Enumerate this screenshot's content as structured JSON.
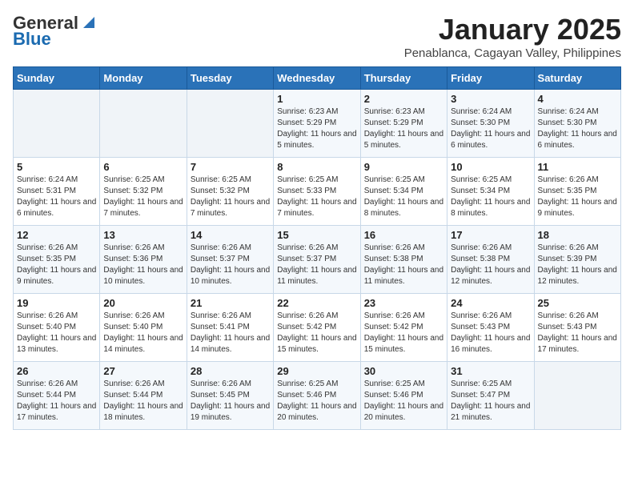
{
  "logo": {
    "general": "General",
    "blue": "Blue"
  },
  "title": "January 2025",
  "location": "Penablanca, Cagayan Valley, Philippines",
  "days_of_week": [
    "Sunday",
    "Monday",
    "Tuesday",
    "Wednesday",
    "Thursday",
    "Friday",
    "Saturday"
  ],
  "weeks": [
    [
      {
        "day": "",
        "sunrise": "",
        "sunset": "",
        "daylight": ""
      },
      {
        "day": "",
        "sunrise": "",
        "sunset": "",
        "daylight": ""
      },
      {
        "day": "",
        "sunrise": "",
        "sunset": "",
        "daylight": ""
      },
      {
        "day": "1",
        "sunrise": "Sunrise: 6:23 AM",
        "sunset": "Sunset: 5:29 PM",
        "daylight": "Daylight: 11 hours and 5 minutes."
      },
      {
        "day": "2",
        "sunrise": "Sunrise: 6:23 AM",
        "sunset": "Sunset: 5:29 PM",
        "daylight": "Daylight: 11 hours and 5 minutes."
      },
      {
        "day": "3",
        "sunrise": "Sunrise: 6:24 AM",
        "sunset": "Sunset: 5:30 PM",
        "daylight": "Daylight: 11 hours and 6 minutes."
      },
      {
        "day": "4",
        "sunrise": "Sunrise: 6:24 AM",
        "sunset": "Sunset: 5:30 PM",
        "daylight": "Daylight: 11 hours and 6 minutes."
      }
    ],
    [
      {
        "day": "5",
        "sunrise": "Sunrise: 6:24 AM",
        "sunset": "Sunset: 5:31 PM",
        "daylight": "Daylight: 11 hours and 6 minutes."
      },
      {
        "day": "6",
        "sunrise": "Sunrise: 6:25 AM",
        "sunset": "Sunset: 5:32 PM",
        "daylight": "Daylight: 11 hours and 7 minutes."
      },
      {
        "day": "7",
        "sunrise": "Sunrise: 6:25 AM",
        "sunset": "Sunset: 5:32 PM",
        "daylight": "Daylight: 11 hours and 7 minutes."
      },
      {
        "day": "8",
        "sunrise": "Sunrise: 6:25 AM",
        "sunset": "Sunset: 5:33 PM",
        "daylight": "Daylight: 11 hours and 7 minutes."
      },
      {
        "day": "9",
        "sunrise": "Sunrise: 6:25 AM",
        "sunset": "Sunset: 5:34 PM",
        "daylight": "Daylight: 11 hours and 8 minutes."
      },
      {
        "day": "10",
        "sunrise": "Sunrise: 6:25 AM",
        "sunset": "Sunset: 5:34 PM",
        "daylight": "Daylight: 11 hours and 8 minutes."
      },
      {
        "day": "11",
        "sunrise": "Sunrise: 6:26 AM",
        "sunset": "Sunset: 5:35 PM",
        "daylight": "Daylight: 11 hours and 9 minutes."
      }
    ],
    [
      {
        "day": "12",
        "sunrise": "Sunrise: 6:26 AM",
        "sunset": "Sunset: 5:35 PM",
        "daylight": "Daylight: 11 hours and 9 minutes."
      },
      {
        "day": "13",
        "sunrise": "Sunrise: 6:26 AM",
        "sunset": "Sunset: 5:36 PM",
        "daylight": "Daylight: 11 hours and 10 minutes."
      },
      {
        "day": "14",
        "sunrise": "Sunrise: 6:26 AM",
        "sunset": "Sunset: 5:37 PM",
        "daylight": "Daylight: 11 hours and 10 minutes."
      },
      {
        "day": "15",
        "sunrise": "Sunrise: 6:26 AM",
        "sunset": "Sunset: 5:37 PM",
        "daylight": "Daylight: 11 hours and 11 minutes."
      },
      {
        "day": "16",
        "sunrise": "Sunrise: 6:26 AM",
        "sunset": "Sunset: 5:38 PM",
        "daylight": "Daylight: 11 hours and 11 minutes."
      },
      {
        "day": "17",
        "sunrise": "Sunrise: 6:26 AM",
        "sunset": "Sunset: 5:38 PM",
        "daylight": "Daylight: 11 hours and 12 minutes."
      },
      {
        "day": "18",
        "sunrise": "Sunrise: 6:26 AM",
        "sunset": "Sunset: 5:39 PM",
        "daylight": "Daylight: 11 hours and 12 minutes."
      }
    ],
    [
      {
        "day": "19",
        "sunrise": "Sunrise: 6:26 AM",
        "sunset": "Sunset: 5:40 PM",
        "daylight": "Daylight: 11 hours and 13 minutes."
      },
      {
        "day": "20",
        "sunrise": "Sunrise: 6:26 AM",
        "sunset": "Sunset: 5:40 PM",
        "daylight": "Daylight: 11 hours and 14 minutes."
      },
      {
        "day": "21",
        "sunrise": "Sunrise: 6:26 AM",
        "sunset": "Sunset: 5:41 PM",
        "daylight": "Daylight: 11 hours and 14 minutes."
      },
      {
        "day": "22",
        "sunrise": "Sunrise: 6:26 AM",
        "sunset": "Sunset: 5:42 PM",
        "daylight": "Daylight: 11 hours and 15 minutes."
      },
      {
        "day": "23",
        "sunrise": "Sunrise: 6:26 AM",
        "sunset": "Sunset: 5:42 PM",
        "daylight": "Daylight: 11 hours and 15 minutes."
      },
      {
        "day": "24",
        "sunrise": "Sunrise: 6:26 AM",
        "sunset": "Sunset: 5:43 PM",
        "daylight": "Daylight: 11 hours and 16 minutes."
      },
      {
        "day": "25",
        "sunrise": "Sunrise: 6:26 AM",
        "sunset": "Sunset: 5:43 PM",
        "daylight": "Daylight: 11 hours and 17 minutes."
      }
    ],
    [
      {
        "day": "26",
        "sunrise": "Sunrise: 6:26 AM",
        "sunset": "Sunset: 5:44 PM",
        "daylight": "Daylight: 11 hours and 17 minutes."
      },
      {
        "day": "27",
        "sunrise": "Sunrise: 6:26 AM",
        "sunset": "Sunset: 5:44 PM",
        "daylight": "Daylight: 11 hours and 18 minutes."
      },
      {
        "day": "28",
        "sunrise": "Sunrise: 6:26 AM",
        "sunset": "Sunset: 5:45 PM",
        "daylight": "Daylight: 11 hours and 19 minutes."
      },
      {
        "day": "29",
        "sunrise": "Sunrise: 6:25 AM",
        "sunset": "Sunset: 5:46 PM",
        "daylight": "Daylight: 11 hours and 20 minutes."
      },
      {
        "day": "30",
        "sunrise": "Sunrise: 6:25 AM",
        "sunset": "Sunset: 5:46 PM",
        "daylight": "Daylight: 11 hours and 20 minutes."
      },
      {
        "day": "31",
        "sunrise": "Sunrise: 6:25 AM",
        "sunset": "Sunset: 5:47 PM",
        "daylight": "Daylight: 11 hours and 21 minutes."
      },
      {
        "day": "",
        "sunrise": "",
        "sunset": "",
        "daylight": ""
      }
    ]
  ]
}
